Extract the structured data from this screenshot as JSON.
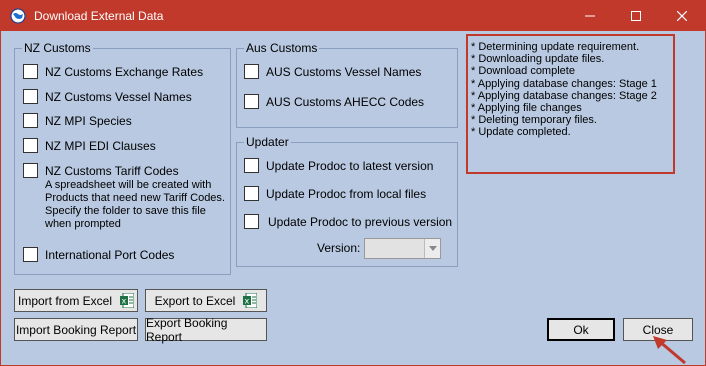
{
  "window": {
    "title": "Download External Data"
  },
  "titlebar": {
    "icons": [
      "minimize-icon",
      "maximize-icon",
      "close-icon"
    ]
  },
  "nz_customs": {
    "legend": "NZ Customs",
    "items": [
      {
        "label": "NZ Customs Exchange Rates",
        "checked": false
      },
      {
        "label": "NZ Customs Vessel Names",
        "checked": false
      },
      {
        "label": "NZ MPI Species",
        "checked": false
      },
      {
        "label": "NZ MPI EDI Clauses",
        "checked": false
      },
      {
        "label": "NZ Customs Tariff Codes",
        "checked": false
      },
      {
        "label": "International Port Codes",
        "checked": false
      }
    ],
    "tariff_note": "A spreadsheet will be created with Products that need new Tariff Codes. Specify the folder to save this file when prompted"
  },
  "aus_customs": {
    "legend": "Aus Customs",
    "items": [
      {
        "label": "AUS Customs Vessel Names",
        "checked": false
      },
      {
        "label": "AUS Customs AHECC Codes",
        "checked": false
      }
    ]
  },
  "updater": {
    "legend": "Updater",
    "items": [
      {
        "label": "Update Prodoc to latest version",
        "checked": false
      },
      {
        "label": "Update Prodoc from local files",
        "checked": false
      },
      {
        "label": "Update Prodoc to previous version",
        "checked": false
      }
    ],
    "version_label": "Version:",
    "version_value": ""
  },
  "log": {
    "lines": [
      "* Determining update requirement.",
      "* Downloading update files.",
      "* Download complete",
      "* Applying database changes: Stage 1",
      "* Applying database changes: Stage 2",
      "* Applying file changes",
      "* Deleting temporary files.",
      "* Update completed."
    ]
  },
  "buttons": {
    "import_excel": "Import from Excel",
    "export_excel": "Export to Excel",
    "import_booking": "Import Booking Report",
    "export_booking": "Export Booking Report",
    "ok": "Ok",
    "close": "Close"
  },
  "colors": {
    "titlebar": "#c0392b",
    "dialog_bg": "#b8c9e1",
    "highlight": "#c0392b"
  }
}
